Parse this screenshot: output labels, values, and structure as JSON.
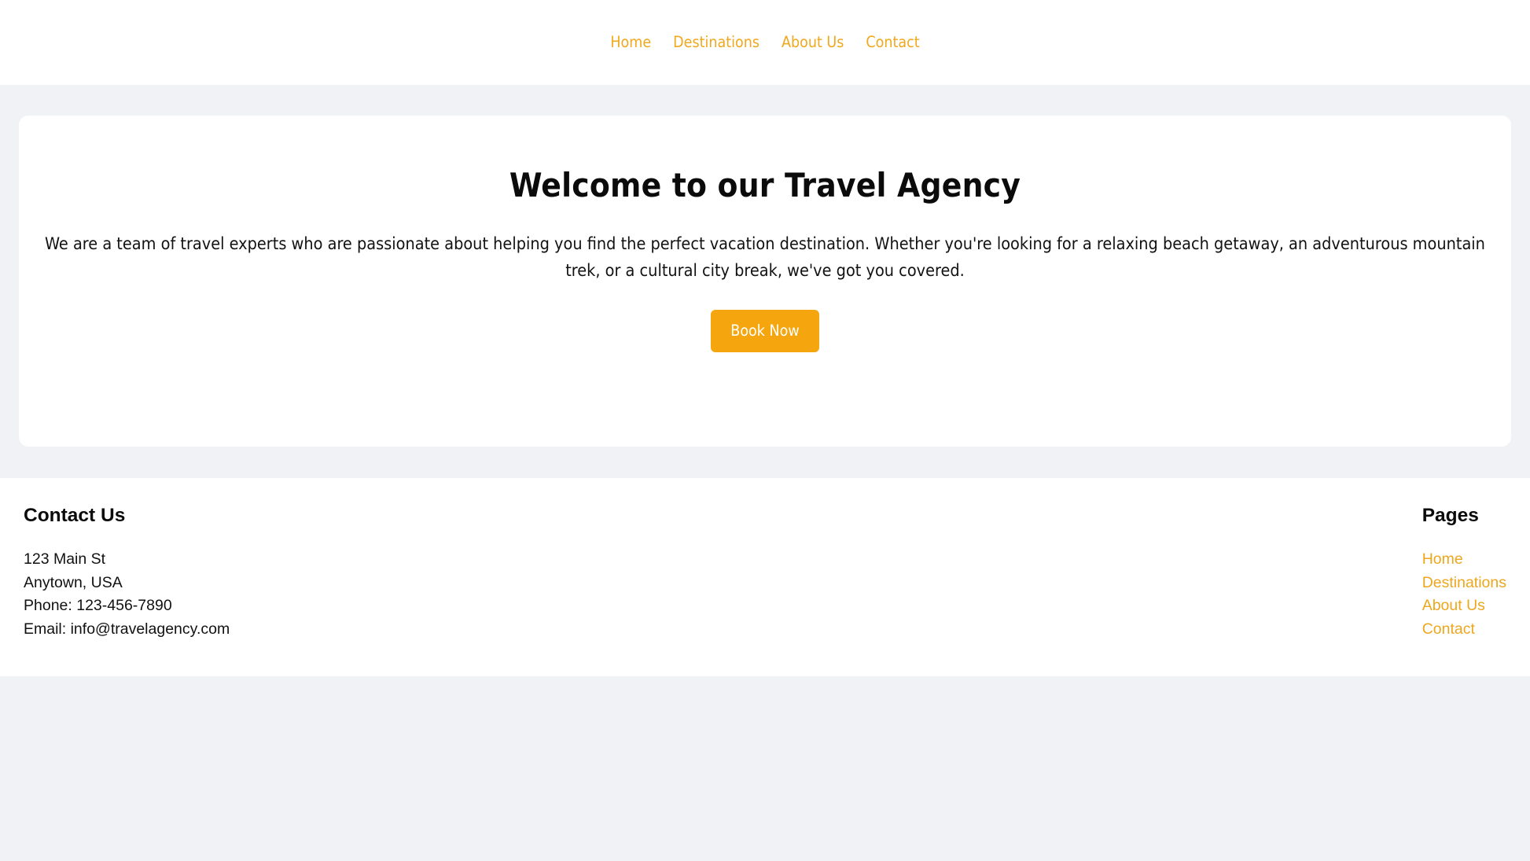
{
  "colors": {
    "page_background": "#f1f2f6",
    "surface": "#ffffff",
    "accent": "#f0a81e",
    "button_background": "#f5a60f",
    "button_text": "#ffffff",
    "heading_text": "#0b0b0b",
    "body_text": "#121212"
  },
  "navbar": {
    "items": [
      {
        "label": "Home"
      },
      {
        "label": "Destinations"
      },
      {
        "label": "About Us"
      },
      {
        "label": "Contact"
      }
    ]
  },
  "hero": {
    "title": "Welcome to our Travel Agency",
    "paragraph": "We are a team of travel experts who are passionate about helping you find the perfect vacation destination. Whether you're looking for a relaxing beach getaway, an adventurous mountain trek, or a cultural city break, we've got you covered.",
    "cta_label": "Book Now"
  },
  "footer": {
    "contact": {
      "heading": "Contact Us",
      "lines": [
        "123 Main St",
        "Anytown, USA",
        "Phone: 123-456-7890",
        "Email: info@travelagency.com"
      ]
    },
    "pages": {
      "heading": "Pages",
      "links": [
        {
          "label": "Home"
        },
        {
          "label": "Destinations"
        },
        {
          "label": "About Us"
        },
        {
          "label": "Contact"
        }
      ]
    }
  }
}
